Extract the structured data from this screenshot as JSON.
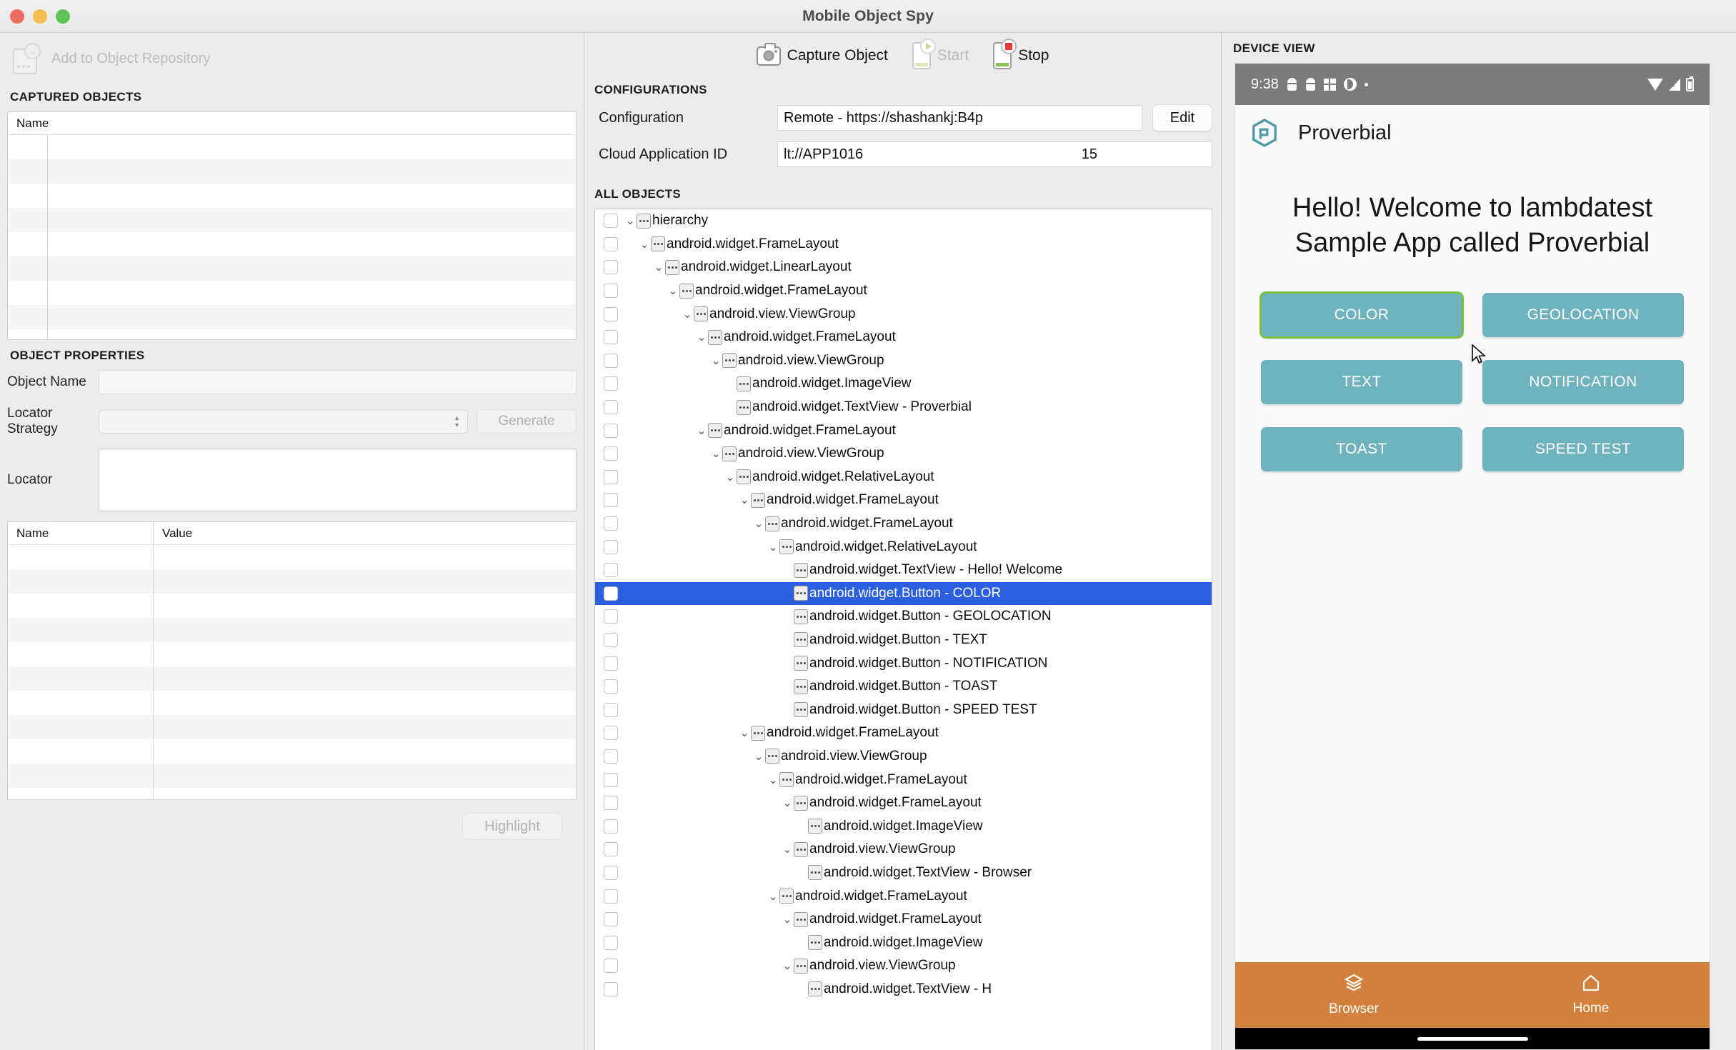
{
  "window": {
    "title": "Mobile Object Spy"
  },
  "left": {
    "add_to_repository_label": "Add to Object Repository",
    "captured_objects_title": "CAPTURED OBJECTS",
    "captured_columns": [
      "Name"
    ],
    "captured_rows": [],
    "object_properties_title": "OBJECT PROPERTIES",
    "object_name_label": "Object Name",
    "object_name_value": "",
    "locator_strategy_label": "Locator Strategy",
    "locator_strategy_value": "",
    "generate_label": "Generate",
    "locator_label": "Locator",
    "locator_value": "",
    "props_columns": [
      "Name",
      "Value"
    ],
    "props_rows": [],
    "highlight_label": "Highlight"
  },
  "toolbar": {
    "capture_object_label": "Capture Object",
    "start_label": "Start",
    "stop_label": "Stop"
  },
  "configurations": {
    "title": "CONFIGURATIONS",
    "configuration_label": "Configuration",
    "configuration_value": "Remote - https://shashankj:B4p",
    "edit_label": "Edit",
    "cloud_app_id_label": "Cloud Application ID",
    "cloud_app_id_value": "lt://APP1016",
    "cloud_app_id_value_tail": "15"
  },
  "all_objects": {
    "title": "ALL OBJECTS",
    "rows": [
      {
        "depth": 0,
        "expanded": true,
        "label": "hierarchy"
      },
      {
        "depth": 1,
        "expanded": true,
        "label": "android.widget.FrameLayout"
      },
      {
        "depth": 2,
        "expanded": true,
        "label": "android.widget.LinearLayout"
      },
      {
        "depth": 3,
        "expanded": true,
        "label": "android.widget.FrameLayout"
      },
      {
        "depth": 4,
        "expanded": true,
        "label": "android.view.ViewGroup"
      },
      {
        "depth": 5,
        "expanded": true,
        "label": "android.widget.FrameLayout"
      },
      {
        "depth": 6,
        "expanded": true,
        "label": "android.view.ViewGroup"
      },
      {
        "depth": 7,
        "expanded": false,
        "label": "android.widget.ImageView"
      },
      {
        "depth": 7,
        "expanded": false,
        "label": "android.widget.TextView - Proverbial"
      },
      {
        "depth": 5,
        "expanded": true,
        "label": "android.widget.FrameLayout"
      },
      {
        "depth": 6,
        "expanded": true,
        "label": "android.view.ViewGroup"
      },
      {
        "depth": 7,
        "expanded": true,
        "label": "android.widget.RelativeLayout"
      },
      {
        "depth": 8,
        "expanded": true,
        "label": "android.widget.FrameLayout"
      },
      {
        "depth": 9,
        "expanded": true,
        "label": "android.widget.FrameLayout"
      },
      {
        "depth": 10,
        "expanded": true,
        "label": "android.widget.RelativeLayout"
      },
      {
        "depth": 11,
        "expanded": false,
        "label": "android.widget.TextView - Hello! Welcome"
      },
      {
        "depth": 11,
        "expanded": false,
        "label": "android.widget.Button - COLOR",
        "selected": true
      },
      {
        "depth": 11,
        "expanded": false,
        "label": "android.widget.Button - GEOLOCATION"
      },
      {
        "depth": 11,
        "expanded": false,
        "label": "android.widget.Button - TEXT"
      },
      {
        "depth": 11,
        "expanded": false,
        "label": "android.widget.Button - NOTIFICATION"
      },
      {
        "depth": 11,
        "expanded": false,
        "label": "android.widget.Button - TOAST"
      },
      {
        "depth": 11,
        "expanded": false,
        "label": "android.widget.Button - SPEED TEST"
      },
      {
        "depth": 8,
        "expanded": true,
        "label": "android.widget.FrameLayout"
      },
      {
        "depth": 9,
        "expanded": true,
        "label": "android.view.ViewGroup"
      },
      {
        "depth": 10,
        "expanded": true,
        "label": "android.widget.FrameLayout"
      },
      {
        "depth": 11,
        "expanded": true,
        "label": "android.widget.FrameLayout"
      },
      {
        "depth": 12,
        "expanded": false,
        "label": "android.widget.ImageView"
      },
      {
        "depth": 11,
        "expanded": true,
        "label": "android.view.ViewGroup"
      },
      {
        "depth": 12,
        "expanded": false,
        "label": "android.widget.TextView - Browser"
      },
      {
        "depth": 10,
        "expanded": true,
        "label": "android.widget.FrameLayout"
      },
      {
        "depth": 11,
        "expanded": true,
        "label": "android.widget.FrameLayout"
      },
      {
        "depth": 12,
        "expanded": false,
        "label": "android.widget.ImageView"
      },
      {
        "depth": 11,
        "expanded": true,
        "label": "android.view.ViewGroup"
      },
      {
        "depth": 12,
        "expanded": false,
        "label": "android.widget.TextView - H"
      }
    ]
  },
  "device_view": {
    "title": "DEVICE VIEW",
    "status_bar": {
      "time": "9:38"
    },
    "app_bar_title": "Proverbial",
    "welcome_text": "Hello! Welcome to lambdatest Sample App called Proverbial",
    "buttons": [
      {
        "label": "COLOR",
        "selected": true
      },
      {
        "label": "GEOLOCATION",
        "selected": false
      },
      {
        "label": "TEXT",
        "selected": false
      },
      {
        "label": "NOTIFICATION",
        "selected": false
      },
      {
        "label": "TOAST",
        "selected": false
      },
      {
        "label": "SPEED TEST",
        "selected": false
      }
    ],
    "bottom_nav": [
      {
        "label": "Browser"
      },
      {
        "label": "Home"
      }
    ]
  },
  "colors": {
    "button_teal": "#6fb3bf",
    "selection_blue": "#2c5fe0",
    "highlight_green": "#7ac143",
    "bottom_nav_orange": "#d2803c",
    "status_bar_gray": "#7b7b7b"
  }
}
